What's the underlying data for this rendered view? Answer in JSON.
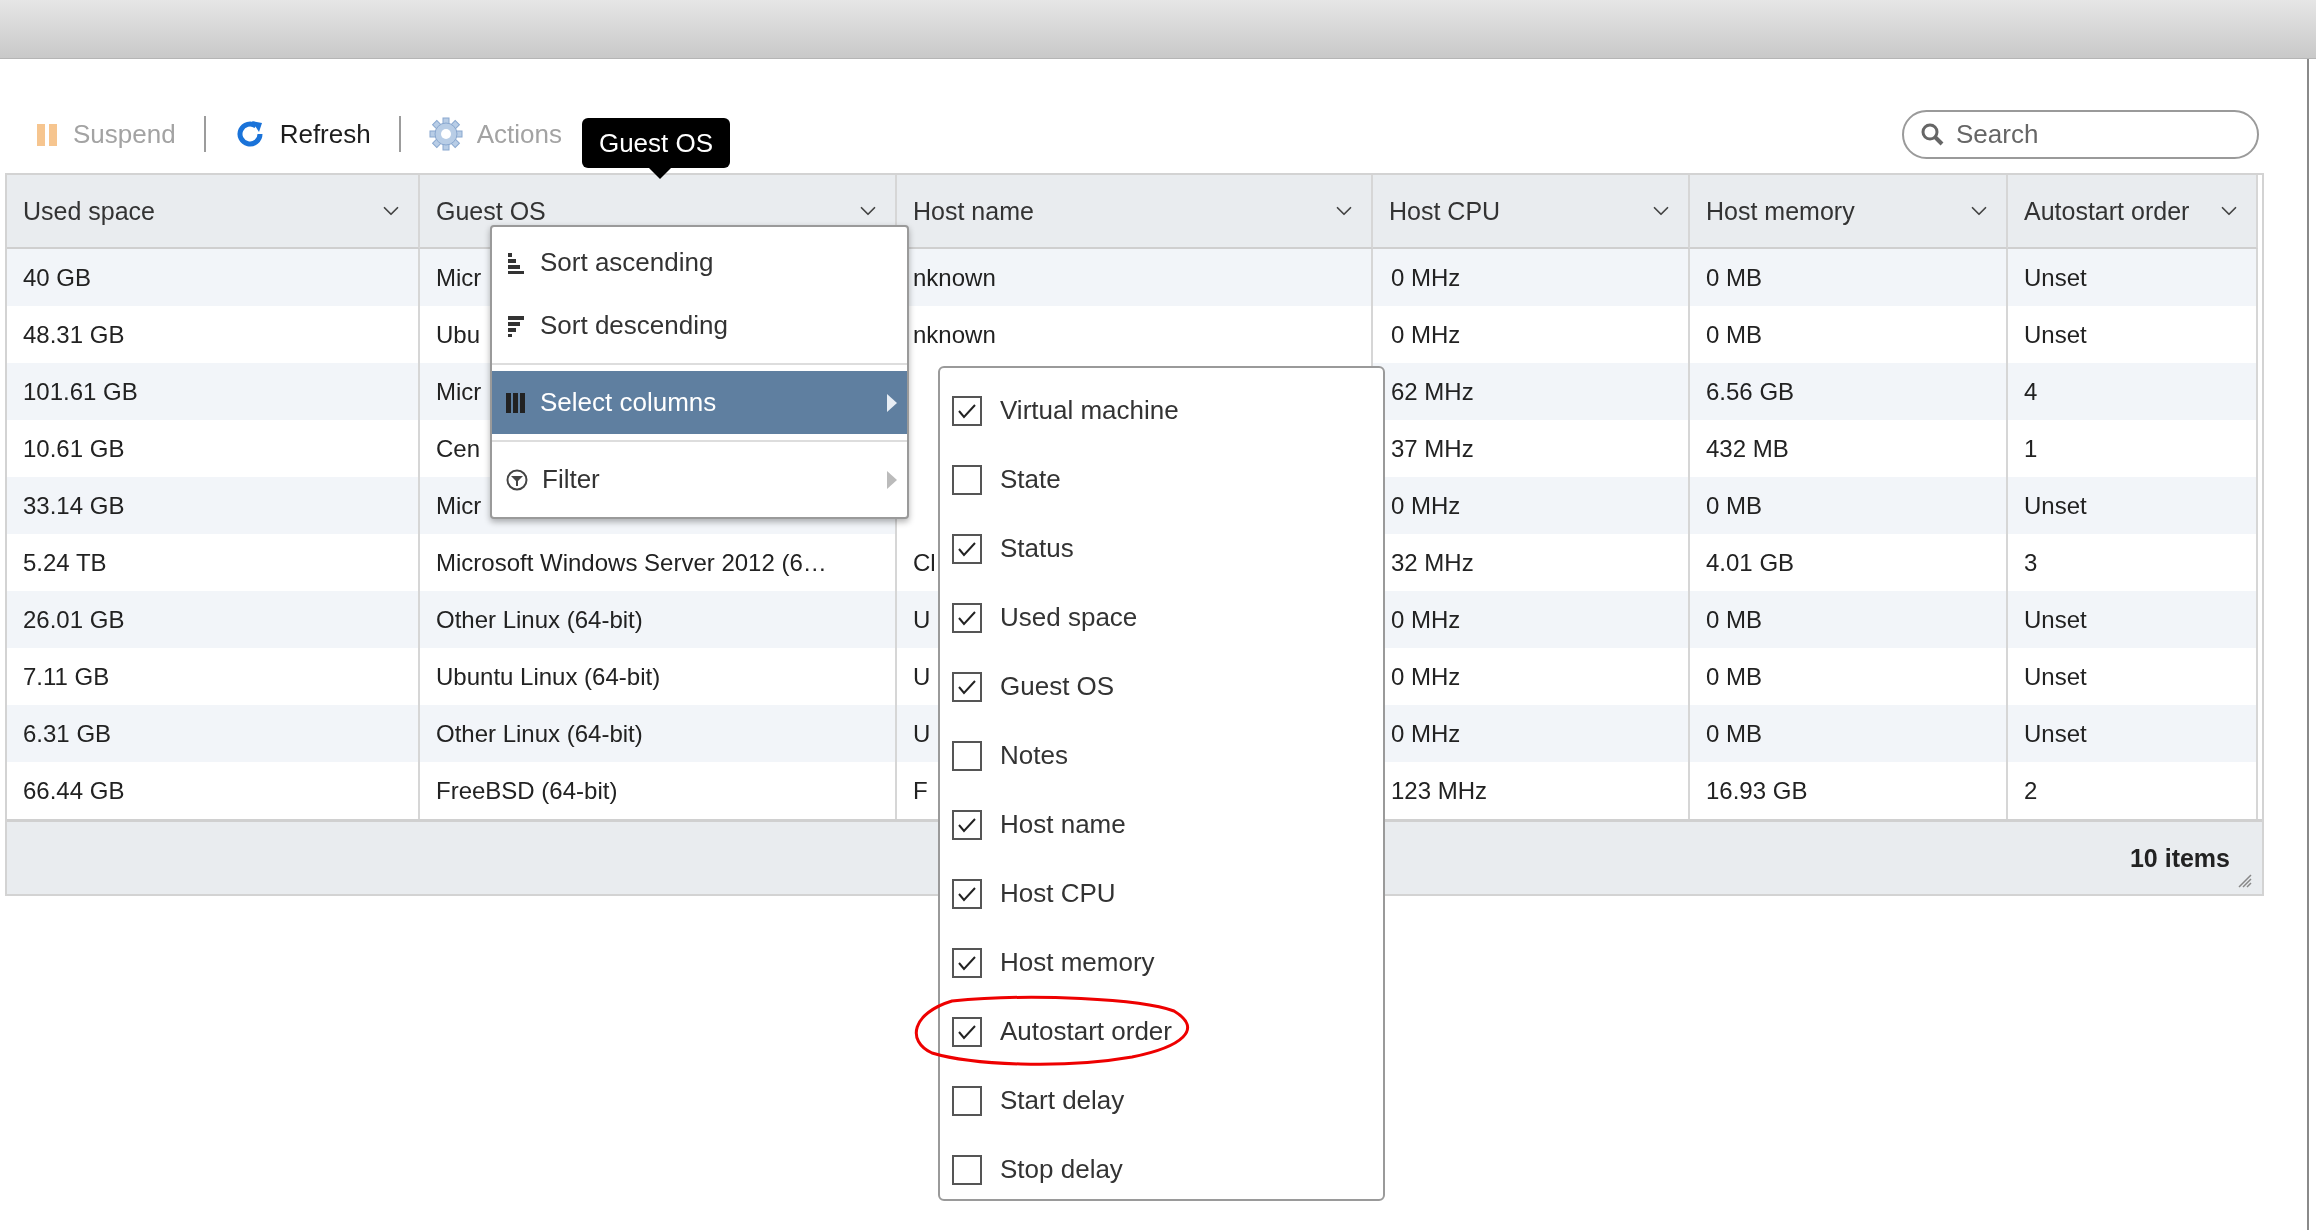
{
  "toolbar": {
    "buttons": [
      {
        "label": "Suspend",
        "kind": "suspend",
        "disabled": true
      },
      {
        "label": "Refresh",
        "kind": "refresh",
        "disabled": false
      },
      {
        "label": "Actions",
        "kind": "actions",
        "disabled": true
      }
    ]
  },
  "search": {
    "placeholder": "Search"
  },
  "tooltip": {
    "text": "Guest OS"
  },
  "table": {
    "columns": [
      "Used space",
      "Guest OS",
      "Host name",
      "Host CPU",
      "Host memory",
      "Autostart order"
    ],
    "rows": [
      [
        "40 GB",
        "Micr",
        "nknown",
        "0 MHz",
        "0 MB",
        "Unset"
      ],
      [
        "48.31 GB",
        "Ubu",
        "nknown",
        "0 MHz",
        "0 MB",
        "Unset"
      ],
      [
        "101.61 GB",
        "Micr",
        null,
        "62 MHz",
        "6.56 GB",
        "4"
      ],
      [
        "10.61 GB",
        "Cen",
        null,
        "37 MHz",
        "432 MB",
        "1"
      ],
      [
        "33.14 GB",
        "Micr",
        null,
        "0 MHz",
        "0 MB",
        "Unset"
      ],
      [
        "5.24 TB",
        "Microsoft Windows Server 2012 (6…",
        "Cl",
        "32 MHz",
        "4.01 GB",
        "3"
      ],
      [
        "26.01 GB",
        "Other Linux (64-bit)",
        "U",
        "0 MHz",
        "0 MB",
        "Unset"
      ],
      [
        "7.11 GB",
        "Ubuntu Linux (64-bit)",
        "U",
        "0 MHz",
        "0 MB",
        "Unset"
      ],
      [
        "6.31 GB",
        "Other Linux (64-bit)",
        "U",
        "0 MHz",
        "0 MB",
        "Unset"
      ],
      [
        "66.44 GB",
        "FreeBSD (64-bit)",
        "F",
        "123 MHz",
        "16.93 GB",
        "2"
      ]
    ]
  },
  "footer": {
    "count": "10 items"
  },
  "column_menu": {
    "items": [
      {
        "label": "Sort ascending",
        "kind": "sort_asc",
        "selected": false,
        "arrow": false
      },
      {
        "label": "Sort descending",
        "kind": "sort_desc",
        "selected": false,
        "arrow": false
      },
      {
        "label": "Select columns",
        "kind": "columns",
        "selected": true,
        "arrow": true
      },
      {
        "label": "Filter",
        "kind": "filter",
        "selected": false,
        "arrow": true
      }
    ]
  },
  "columns_submenu": {
    "items": [
      {
        "label": "Virtual machine",
        "checked": true,
        "circled": false
      },
      {
        "label": "State",
        "checked": false,
        "circled": false
      },
      {
        "label": "Status",
        "checked": true,
        "circled": false
      },
      {
        "label": "Used space",
        "checked": true,
        "circled": false
      },
      {
        "label": "Guest OS",
        "checked": true,
        "circled": false
      },
      {
        "label": "Notes",
        "checked": false,
        "circled": false
      },
      {
        "label": "Host name",
        "checked": true,
        "circled": false
      },
      {
        "label": "Host CPU",
        "checked": true,
        "circled": false
      },
      {
        "label": "Host memory",
        "checked": true,
        "circled": false
      },
      {
        "label": "Autostart order",
        "checked": true,
        "circled": true
      },
      {
        "label": "Start delay",
        "checked": false,
        "circled": false
      },
      {
        "label": "Stop delay",
        "checked": false,
        "circled": false
      }
    ]
  }
}
